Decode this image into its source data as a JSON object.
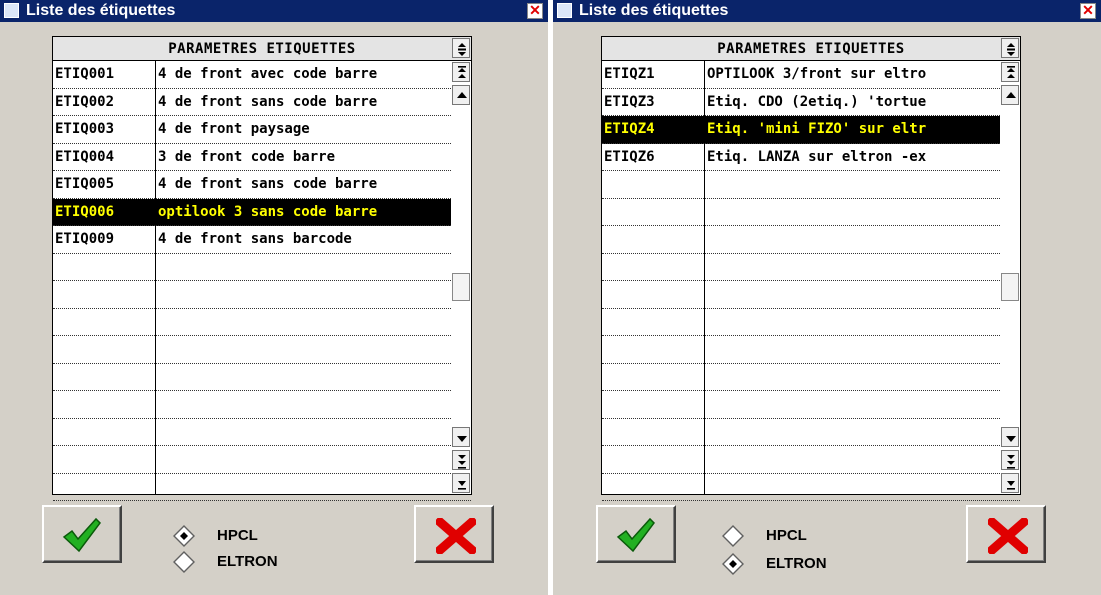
{
  "windows": [
    {
      "title": "Liste des étiquettes",
      "close_symbol": "✕",
      "grid": {
        "header": "PARAMETRES ETIQUETTES",
        "rows": [
          {
            "code": "ETIQ001",
            "desc": "4 de front avec code barre"
          },
          {
            "code": "ETIQ002",
            "desc": "4 de front sans code barre"
          },
          {
            "code": "ETIQ003",
            "desc": "4 de front paysage"
          },
          {
            "code": "ETIQ004",
            "desc": "3 de front code barre"
          },
          {
            "code": "ETIQ005",
            "desc": "4 de front sans code barre"
          },
          {
            "code": "ETIQ006",
            "desc": "optilook 3 sans code barre",
            "selected": true
          },
          {
            "code": "ETIQ009",
            "desc": "4 de front sans barcode"
          },
          {
            "code": "",
            "desc": ""
          },
          {
            "code": "",
            "desc": ""
          },
          {
            "code": "",
            "desc": ""
          },
          {
            "code": "",
            "desc": ""
          },
          {
            "code": "",
            "desc": ""
          },
          {
            "code": "",
            "desc": ""
          },
          {
            "code": "",
            "desc": ""
          },
          {
            "code": "",
            "desc": ""
          },
          {
            "code": "",
            "desc": ""
          }
        ]
      },
      "radio": {
        "options": [
          "HPCL",
          "ELTRON"
        ],
        "selected": "HPCL"
      }
    },
    {
      "title": "Liste des étiquettes",
      "close_symbol": "✕",
      "grid": {
        "header": "PARAMETRES ETIQUETTES",
        "rows": [
          {
            "code": "ETIQZ1",
            "desc": "OPTILOOK 3/front sur eltro"
          },
          {
            "code": "ETIQZ3",
            "desc": "Etiq. CDO (2etiq.) 'tortue"
          },
          {
            "code": "ETIQZ4",
            "desc": "Etiq. 'mini FIZO' sur eltr",
            "selected": true
          },
          {
            "code": "ETIQZ6",
            "desc": "Etiq. LANZA sur eltron -ex"
          },
          {
            "code": "",
            "desc": ""
          },
          {
            "code": "",
            "desc": ""
          },
          {
            "code": "",
            "desc": ""
          },
          {
            "code": "",
            "desc": ""
          },
          {
            "code": "",
            "desc": ""
          },
          {
            "code": "",
            "desc": ""
          },
          {
            "code": "",
            "desc": ""
          },
          {
            "code": "",
            "desc": ""
          },
          {
            "code": "",
            "desc": ""
          },
          {
            "code": "",
            "desc": ""
          },
          {
            "code": "",
            "desc": ""
          },
          {
            "code": "",
            "desc": ""
          }
        ]
      },
      "radio": {
        "options": [
          "HPCL",
          "ELTRON"
        ],
        "selected": "ELTRON"
      }
    }
  ],
  "icons": {
    "ok": "green-checkmark-icon",
    "cancel": "red-x-icon"
  },
  "colors": {
    "titlebar": "#0a246a",
    "selected_bg": "#000000",
    "selected_text": "#ffff00",
    "ok": "#22b022",
    "cancel": "#e00000"
  }
}
